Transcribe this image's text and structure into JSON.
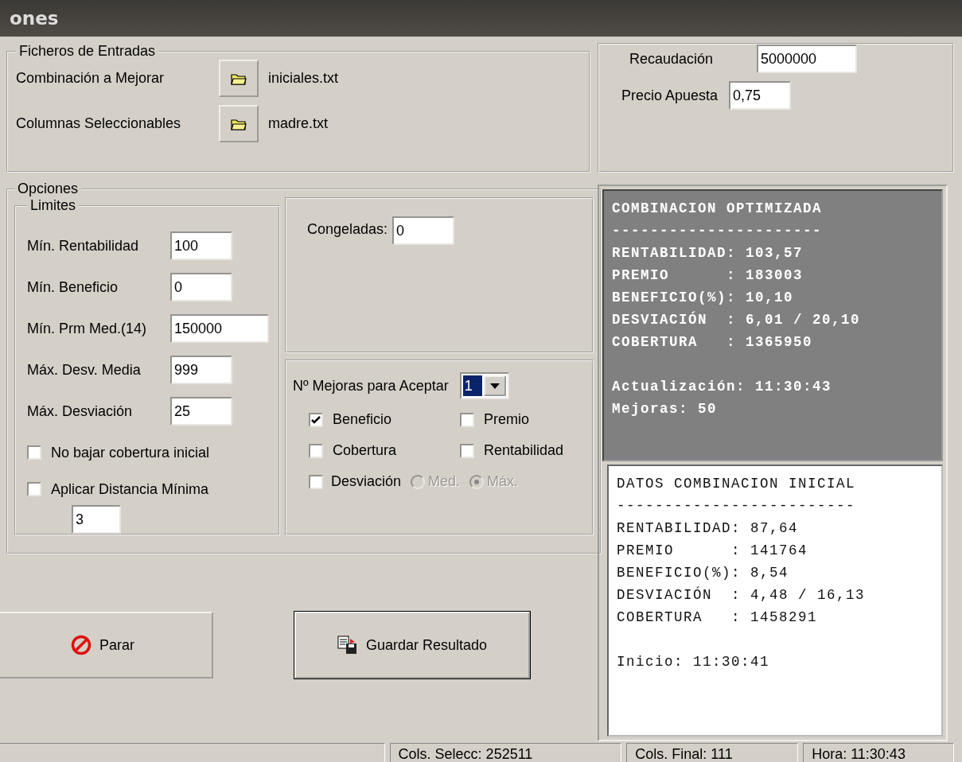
{
  "window": {
    "title": "ones"
  },
  "input_files": {
    "title": "Ficheros de Entradas",
    "rows": [
      {
        "label": "Combinación a Mejorar",
        "file": "iniciales.txt"
      },
      {
        "label": "Columnas Seleccionables",
        "file": "madre.txt"
      }
    ]
  },
  "amounts": [
    {
      "label": "Recaudación",
      "value": "5000000"
    },
    {
      "label": "Precio Apuesta",
      "value": "0,75"
    }
  ],
  "options": {
    "title": "Opciones",
    "limits": {
      "title": "Limites",
      "fields": [
        {
          "label": "Mín. Rentabilidad",
          "value": "100",
          "kind": "short"
        },
        {
          "label": "Mín. Beneficio",
          "value": "0",
          "kind": "short"
        },
        {
          "label": "Mín. Prm Med.(14)",
          "value": "150000",
          "kind": "long"
        },
        {
          "label": "Máx. Desv. Media",
          "value": "999",
          "kind": "short"
        },
        {
          "label": "Máx. Desviación",
          "value": "25",
          "kind": "short"
        }
      ],
      "checks": [
        {
          "label": "No bajar cobertura inicial",
          "checked": false
        },
        {
          "label": "Aplicar Distancia Mínima",
          "checked": false
        }
      ],
      "distance": "3"
    },
    "frozen": {
      "label": "Congeladas:",
      "value": "0"
    },
    "improvements": {
      "label": "Nº Mejoras para Aceptar",
      "value": "1",
      "criteria": [
        {
          "label": "Beneficio",
          "checked": true
        },
        {
          "label": "Premio",
          "checked": false
        },
        {
          "label": "Cobertura",
          "checked": false
        },
        {
          "label": "Rentabilidad",
          "checked": false
        },
        {
          "label": "Desviación",
          "checked": false
        }
      ],
      "deviation_modes": [
        {
          "label": "Med.",
          "selected": false,
          "disabled": true
        },
        {
          "label": "Máx.",
          "selected": true,
          "disabled": true
        }
      ]
    }
  },
  "optimized": {
    "groups": [
      [
        "COMBINACION OPTIMIZADA",
        "----------------------",
        "RENTABILIDAD: 103,57",
        "PREMIO      : 183003",
        "BENEFICIO(%): 10,10",
        "DESVIACIÓN  : 6,01 / 20,10",
        "COBERTURA   : 1365950"
      ],
      [
        "Actualización: 11:30:43",
        "Mejoras: 50"
      ]
    ]
  },
  "initial": {
    "groups": [
      [
        "DATOS COMBINACION INICIAL",
        "-------------------------",
        "RENTABILIDAD: 87,64",
        "PREMIO      : 141764",
        "BENEFICIO(%): 8,54",
        "DESVIACIÓN  : 4,48 / 16,13",
        "COBERTURA   : 1458291"
      ],
      [
        "Inicio: 11:30:41"
      ]
    ]
  },
  "buttons": [
    {
      "kind": "stop",
      "label": "Parar"
    },
    {
      "kind": "save",
      "label": "Guardar Resultado"
    }
  ],
  "status_bar": [
    "Cols. Selecc: 252511",
    "Cols. Final: 111",
    "Hora: 11:30:43"
  ]
}
